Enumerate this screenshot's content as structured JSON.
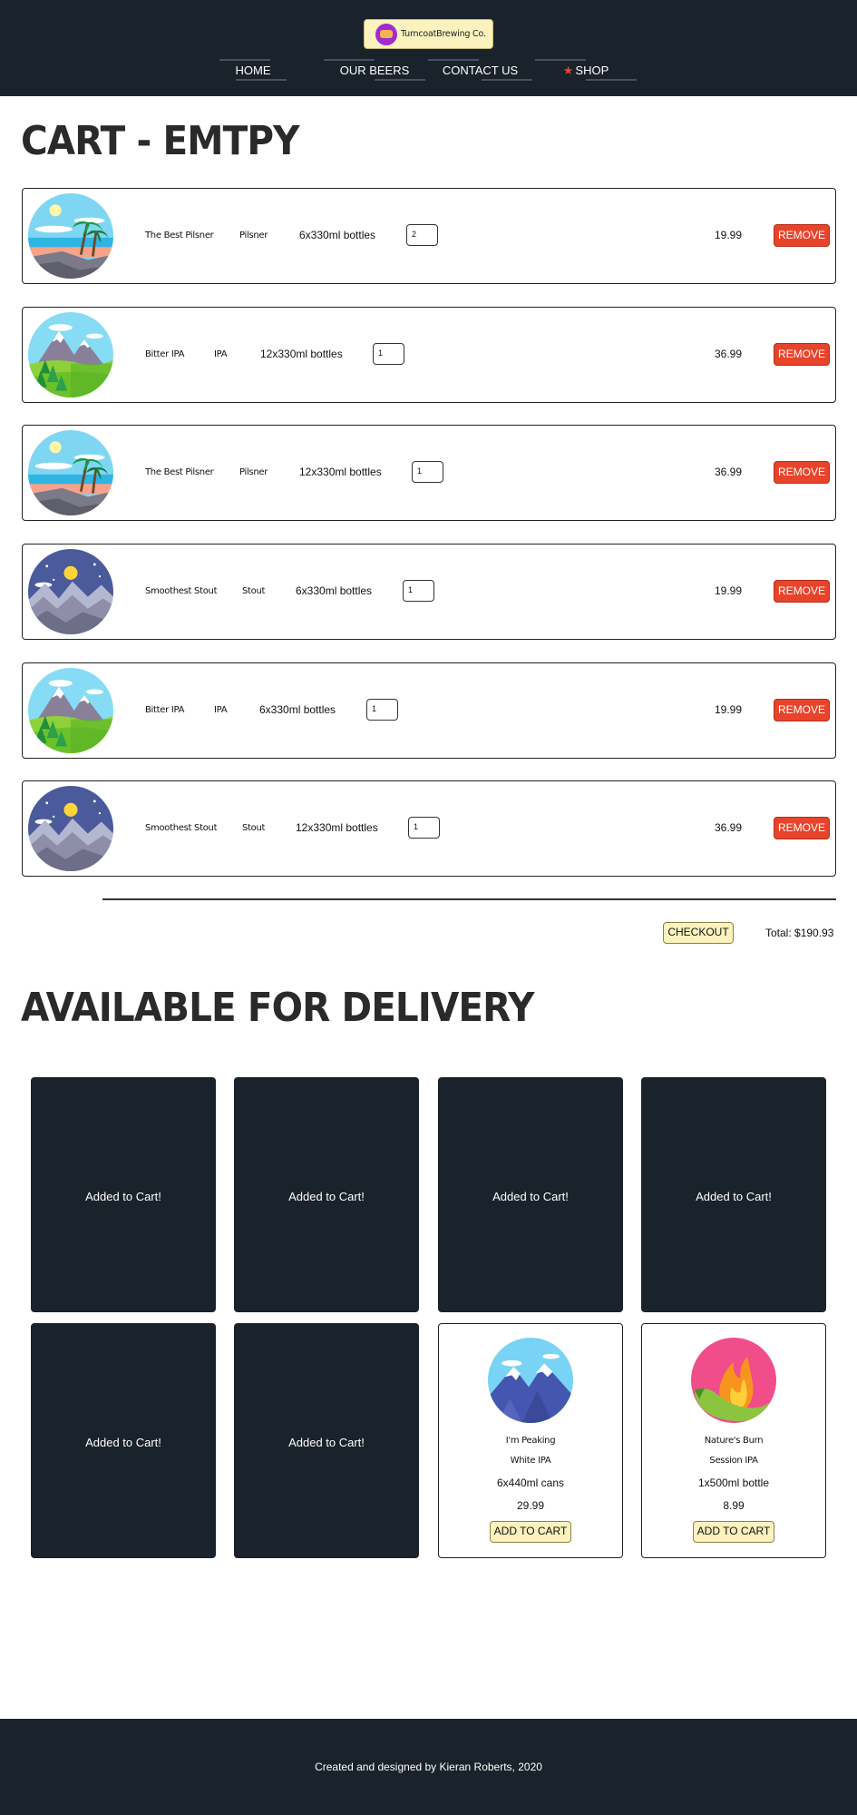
{
  "header": {
    "logo_text": "TurncoatBrewing Co.",
    "nav": [
      "HOME",
      "OUR BEERS",
      "CONTACT US",
      "SHOP"
    ],
    "nav_active": "SHOP"
  },
  "cart": {
    "title": "CART - EMTPY",
    "items": [
      {
        "name": "The Best Pilsner",
        "style": "Pilsner",
        "size": "6x330ml bottles",
        "qty": "2",
        "price": "19.99",
        "image": "beach-palm-icon",
        "remove_label": "REMOVE"
      },
      {
        "name": "Bitter IPA",
        "style": "IPA",
        "size": "12x330ml bottles",
        "qty": "1",
        "price": "36.99",
        "image": "mountain-forest-icon",
        "remove_label": "REMOVE"
      },
      {
        "name": "The Best Pilsner",
        "style": "Pilsner",
        "size": "12x330ml bottles",
        "qty": "1",
        "price": "36.99",
        "image": "beach-palm-icon",
        "remove_label": "REMOVE"
      },
      {
        "name": "Smoothest Stout",
        "style": "Stout",
        "size": "6x330ml bottles",
        "qty": "1",
        "price": "19.99",
        "image": "night-moon-icon",
        "remove_label": "REMOVE"
      },
      {
        "name": "Bitter IPA",
        "style": "IPA",
        "size": "6x330ml bottles",
        "qty": "1",
        "price": "19.99",
        "image": "mountain-forest-icon",
        "remove_label": "REMOVE"
      },
      {
        "name": "Smoothest Stout",
        "style": "Stout",
        "size": "12x330ml bottles",
        "qty": "1",
        "price": "36.99",
        "image": "night-moon-icon",
        "remove_label": "REMOVE"
      }
    ],
    "checkout_label": "CHECKOUT",
    "total": "Total: $190.93"
  },
  "available": {
    "title": "AVAILABLE FOR DELIVERY",
    "added_text": "Added to Cart!",
    "products": [
      {
        "name": "I'm Peaking",
        "style": "White IPA",
        "size": "6x440ml cans",
        "price": "29.99",
        "add_label": "ADD TO CART",
        "image": "snowy-peaks-icon"
      },
      {
        "name": "Nature's Burn",
        "style": "Session IPA",
        "size": "1x500ml bottle",
        "price": "8.99",
        "add_label": "ADD TO CART",
        "image": "chili-flame-icon"
      }
    ]
  },
  "footer": {
    "text": "Created and designed by Kieran Roberts, 2020"
  },
  "colors": {
    "header_bg": "#1a222b",
    "accent_red": "#e8442b",
    "cream": "#fbf2be"
  }
}
